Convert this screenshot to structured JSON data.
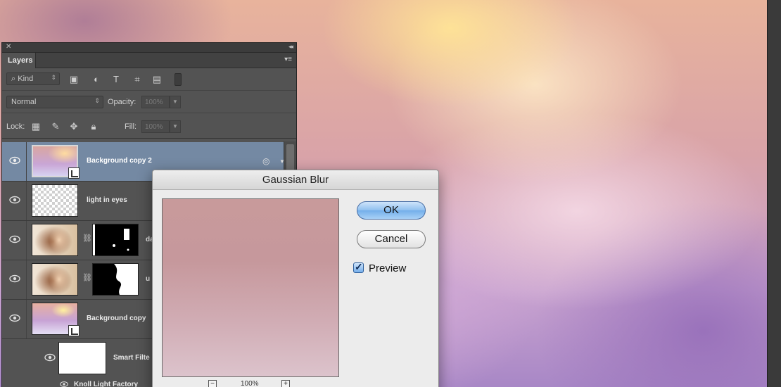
{
  "layers_panel": {
    "tab_label": "Layers",
    "filter": {
      "kind_label": "Kind"
    },
    "blend_mode": "Normal",
    "opacity": {
      "label": "Opacity:",
      "value": "100%"
    },
    "lock": {
      "label": "Lock:"
    },
    "fill": {
      "label": "Fill:",
      "value": "100%"
    },
    "layers": [
      {
        "name": "Background copy 2",
        "selected": true
      },
      {
        "name": "light in eyes",
        "selected": false
      },
      {
        "name": "da",
        "selected": false
      },
      {
        "name": "u",
        "selected": false
      },
      {
        "name": "Background copy",
        "selected": false
      }
    ],
    "smart_filters_label": "Smart Filte",
    "filter_item_label": "Knoll Light Factory"
  },
  "dialog": {
    "title": "Gaussian Blur",
    "ok_label": "OK",
    "cancel_label": "Cancel",
    "preview_label": "Preview",
    "preview_checked": true,
    "zoom_level": "100%",
    "zoom_out": "−",
    "zoom_in": "+"
  },
  "colors": {
    "selected_layer": "#7489a3",
    "panel_bg": "#535353",
    "ok_button": "#8fbfef"
  }
}
